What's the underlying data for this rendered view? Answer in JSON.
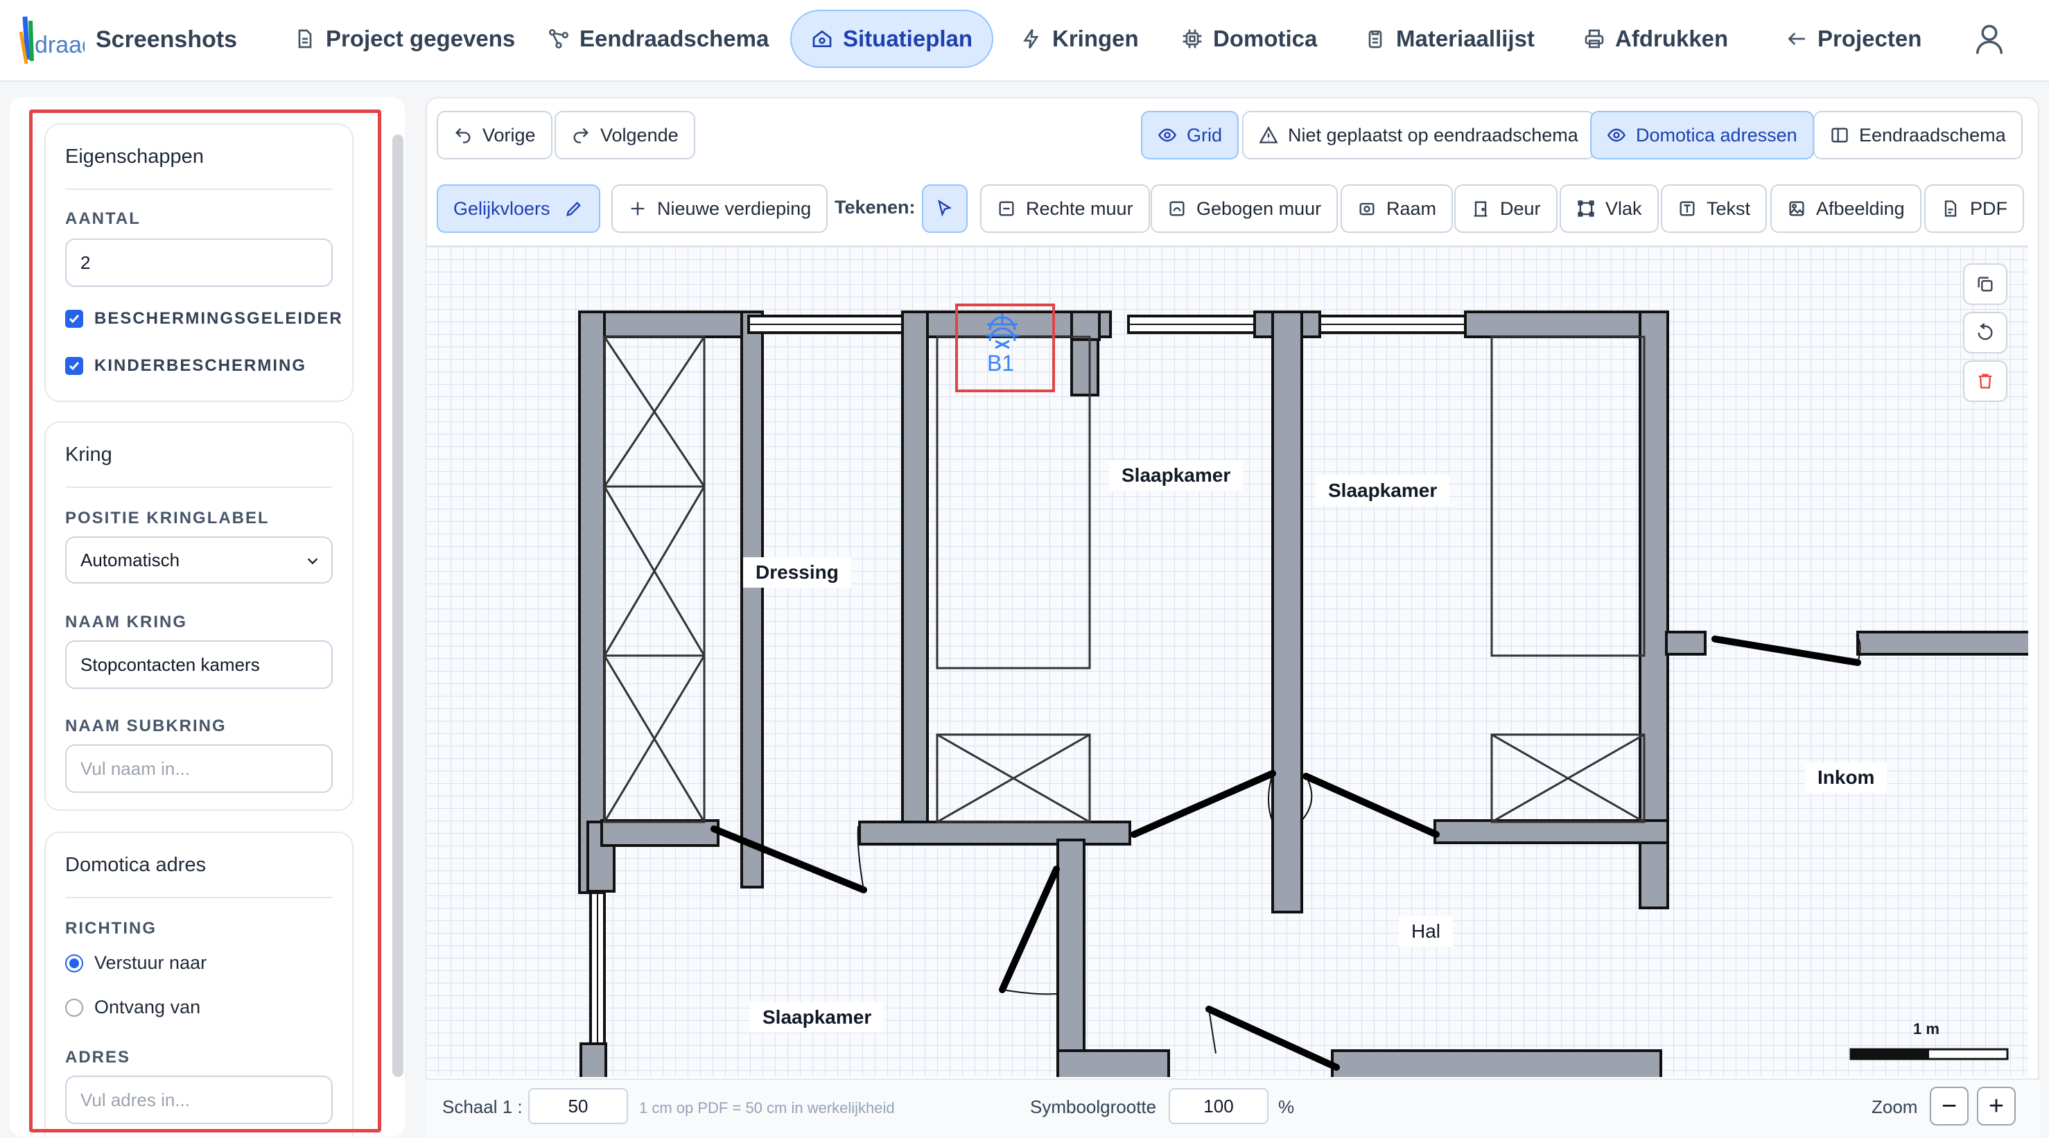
{
  "nav": {
    "brand": "Screenshots",
    "items": [
      {
        "label": "Project gegevens",
        "icon": "document-icon"
      },
      {
        "label": "Eendraadschema",
        "icon": "share-nodes-icon"
      },
      {
        "label": "Situatieplan",
        "icon": "home-icon",
        "active": true
      },
      {
        "label": "Kringen",
        "icon": "lightning-icon"
      },
      {
        "label": "Domotica",
        "icon": "chip-icon"
      },
      {
        "label": "Materiaallijst",
        "icon": "clipboard-icon"
      },
      {
        "label": "Afdrukken",
        "icon": "printer-icon"
      },
      {
        "label": "Projecten",
        "icon": "arrow-left-icon"
      }
    ]
  },
  "sidebar": {
    "properties": {
      "title": "Eigenschappen",
      "count_label": "AANTAL",
      "count_value": "2",
      "checkbox1": "BESCHERMINGSGELEIDER",
      "checkbox2": "KINDERBESCHERMING"
    },
    "circuit": {
      "title": "Kring",
      "position_label": "POSITIE KRINGLABEL",
      "position_value": "Automatisch",
      "name_label": "NAAM KRING",
      "name_value": "Stopcontacten kamers",
      "subname_label": "NAAM SUBKRING",
      "subname_placeholder": "Vul naam in..."
    },
    "domotics": {
      "title": "Domotica adres",
      "direction_label": "RICHTING",
      "option_send": "Verstuur naar",
      "option_receive": "Ontvang van",
      "address_label": "ADRES",
      "address_placeholder": "Vul adres in..."
    }
  },
  "toolbar": {
    "previous": "Vorige",
    "next": "Volgende",
    "grid": "Grid",
    "not_placed": "Niet geplaatst op eendraadschema",
    "domotics_addresses": "Domotica adressen",
    "single_line": "Eendraadschema",
    "floor": "Gelijkvloers",
    "new_floor": "Nieuwe verdieping",
    "draw_label": "Tekenen:",
    "straight_wall": "Rechte muur",
    "curved_wall": "Gebogen muur",
    "window": "Raam",
    "door": "Deur",
    "area": "Vlak",
    "text": "Tekst",
    "image": "Afbeelding",
    "pdf": "PDF"
  },
  "plan": {
    "rooms": [
      "Dressing",
      "Slaapkamer",
      "Slaapkamer",
      "Inkom",
      "Hal",
      "Slaapkamer"
    ],
    "symbol_label": "B1",
    "scale_bar_label": "1 m"
  },
  "footer": {
    "scale_label": "Schaal 1 :",
    "scale_value": "50",
    "scale_hint": "1 cm op PDF = 50 cm in werkelijkheid",
    "symbol_size_label": "Symboolgrootte",
    "symbol_size_value": "100",
    "percent": "%",
    "zoom_label": "Zoom",
    "zoom_out": "−",
    "zoom_in": "+"
  },
  "colors": {
    "accent": "#2563eb",
    "active_bg": "#dbeafe",
    "selection": "#e04444",
    "wall_fill": "#9ca3af"
  }
}
